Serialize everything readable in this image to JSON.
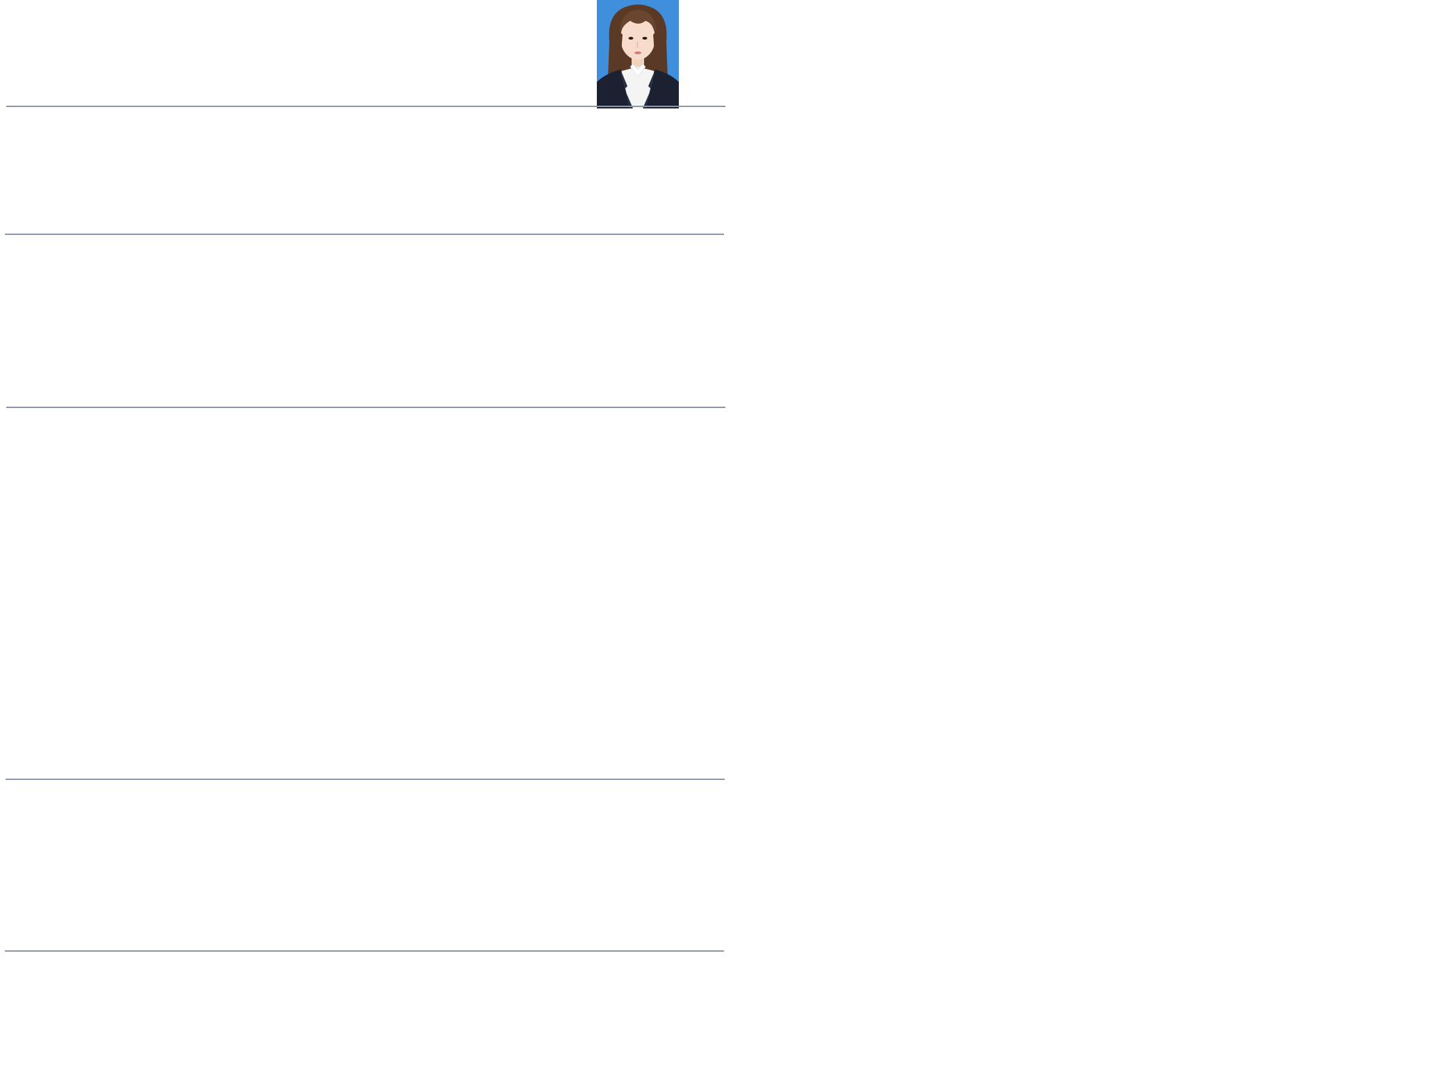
{
  "document": {
    "profile_photo": {
      "icon": "portrait-photo",
      "background_color": "#3f8fdc"
    },
    "section_rule_color": "#8a97a8",
    "section_count": 5
  }
}
